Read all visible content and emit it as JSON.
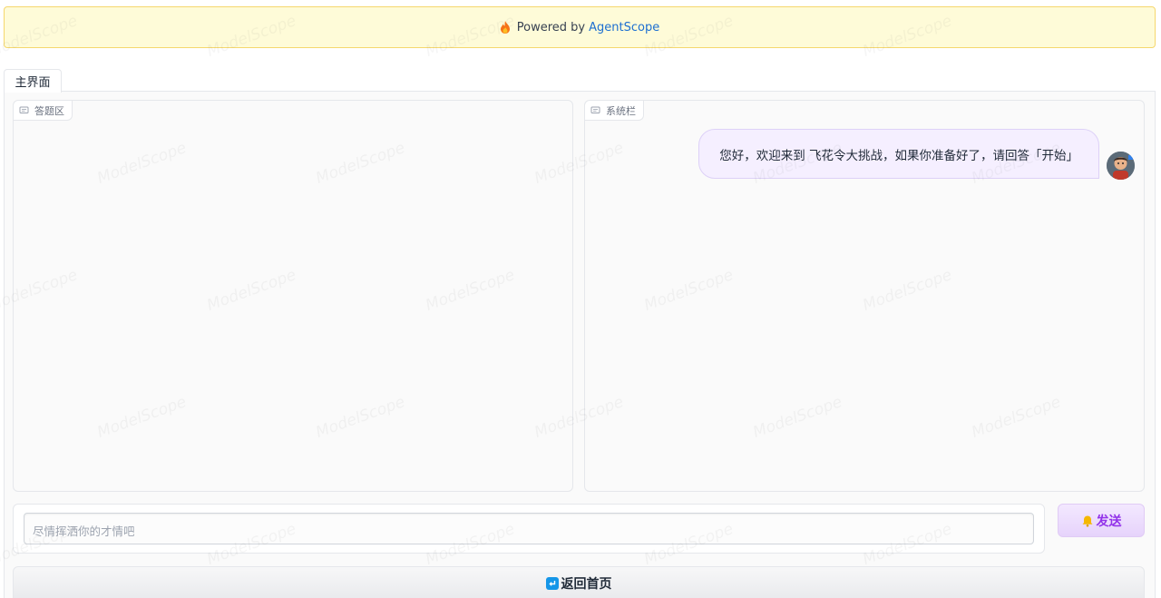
{
  "banner": {
    "prefix": "Powered by",
    "link_text": "AgentScope",
    "flame_icon": "flame-icon",
    "link_color": "#1d6fd1"
  },
  "tabs": [
    {
      "label": "主界面",
      "active": true
    }
  ],
  "answer_panel": {
    "label": "答题区",
    "icon": "chat-icon",
    "messages": []
  },
  "system_panel": {
    "label": "系统栏",
    "icon": "chat-icon",
    "messages": [
      {
        "text": "您好，欢迎来到 飞花令大挑战，如果你准备好了，请回答「开始」",
        "avatar": "avatar"
      }
    ]
  },
  "input": {
    "value": "",
    "placeholder": "尽情挥洒你的才情吧"
  },
  "send_button": {
    "label": "发送",
    "icon": "bell-icon",
    "color": "#9333ea"
  },
  "home_button": {
    "label": "返回首页",
    "icon": "return-icon"
  },
  "watermark": "ModelScope"
}
